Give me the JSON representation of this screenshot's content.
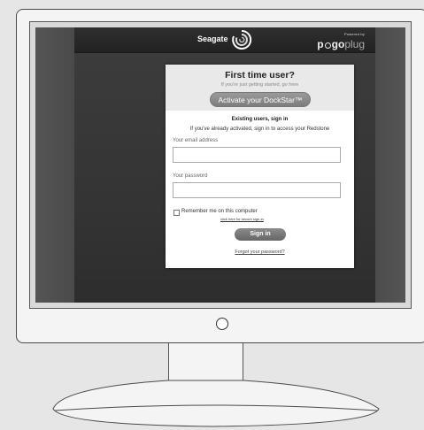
{
  "header": {
    "brand": "Seagate",
    "powered_by": "Powered by",
    "pogo_prefix": "p",
    "pogo_mid": "go",
    "pogo_suffix": "plug"
  },
  "first_time": {
    "title": "First time user?",
    "subtitle": "If you're just getting started, go here",
    "activate_label": "Activate your DockStar™"
  },
  "signin": {
    "heading": "Existing users, sign in",
    "note": "If you've already activated, sign in to access your Redstone",
    "email_label": "Your email address",
    "email_value": "",
    "password_label": "Your password",
    "password_value": "",
    "remember_label": "Remember me on this computer",
    "secure_link": "click here for secure sign-in",
    "signin_label": "Sign in",
    "forgot_label": "Forgot your password?"
  },
  "colors": {
    "screen_bg": "#3c3c3c",
    "card_top": "#e9e9e9",
    "button": "#8a8a8a"
  }
}
